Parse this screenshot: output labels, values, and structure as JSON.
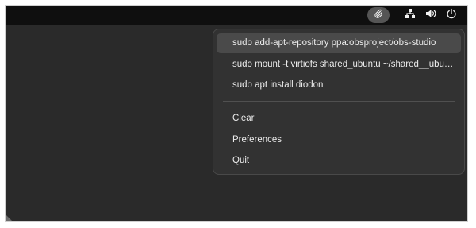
{
  "clipboard_menu": {
    "history": [
      {
        "label": "sudo add-apt-repository ppa:obsproject/obs-studio",
        "active": true
      },
      {
        "label": "sudo mount -t virtiofs shared_ubuntu ~/shared__ubuntu",
        "active": false
      },
      {
        "label": "sudo apt install diodon",
        "active": false
      }
    ],
    "actions": {
      "clear": "Clear",
      "preferences": "Preferences",
      "quit": "Quit"
    }
  },
  "tray_icons": {
    "clipboard": "paperclip-icon",
    "network": "network-icon",
    "volume": "speaker-icon",
    "power": "power-icon"
  },
  "colors": {
    "desktop": "#2a2a2a",
    "top_bar": "#0f0f0f",
    "menu_background": "#323232",
    "menu_highlight": "#4a4a4a",
    "text": "#ececec"
  }
}
